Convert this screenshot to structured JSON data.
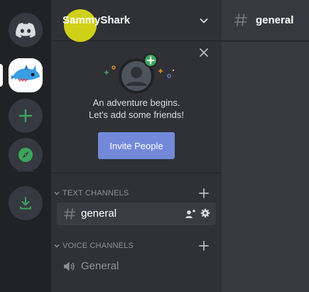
{
  "servers": {
    "home_icon": "discord-logo-icon",
    "active_server_icon": "shark-avatar-icon",
    "add_icon": "plus-icon",
    "explore_icon": "compass-icon",
    "download_icon": "download-icon"
  },
  "guild": {
    "name": "SammyShark"
  },
  "welcome": {
    "line1": "An adventure begins.",
    "line2": "Let's add some friends!",
    "invite_label": "Invite People"
  },
  "categories": {
    "text": "TEXT CHANNELS",
    "voice": "VOICE CHANNELS"
  },
  "channels": {
    "text": [
      {
        "name": "general"
      }
    ],
    "voice": [
      {
        "name": "General"
      }
    ]
  },
  "main": {
    "channel_name": "general"
  },
  "colors": {
    "rail": "#202225",
    "sidebar": "#2f3136",
    "main": "#36393f",
    "accent_green": "#3ba55d",
    "blurple": "#7289da",
    "cursor_highlight": "#e6e614"
  }
}
